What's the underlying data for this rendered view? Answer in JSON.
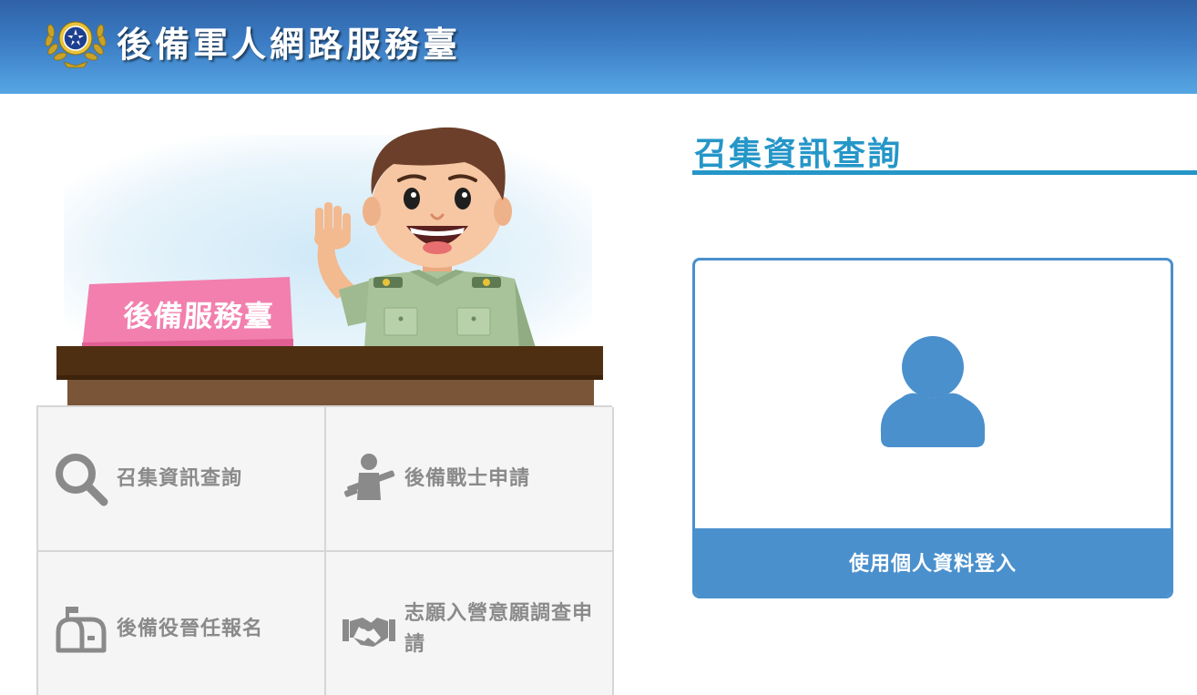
{
  "header": {
    "site_title": "後備軍人網路服務臺",
    "emblem_icon": "military-emblem-icon"
  },
  "hero": {
    "sign_text": "後備服務臺"
  },
  "menu": {
    "tiles": [
      {
        "label": "召集資訊查詢",
        "icon": "search-icon"
      },
      {
        "label": "後備戰士申請",
        "icon": "soldier-rifle-icon"
      },
      {
        "label": "後備役晉任報名",
        "icon": "mailbox-icon"
      },
      {
        "label": "志願入營意願調查申請",
        "icon": "handshake-icon"
      }
    ]
  },
  "main": {
    "title": "召集資訊查詢",
    "login_card": {
      "icon": "user-avatar-icon",
      "button_label": "使用個人資料登入"
    }
  },
  "colors": {
    "accent": "#2596c8",
    "card_blue": "#4a90cd",
    "tile_text": "#8a8a8a",
    "tile_bg": "#f5f5f5"
  }
}
